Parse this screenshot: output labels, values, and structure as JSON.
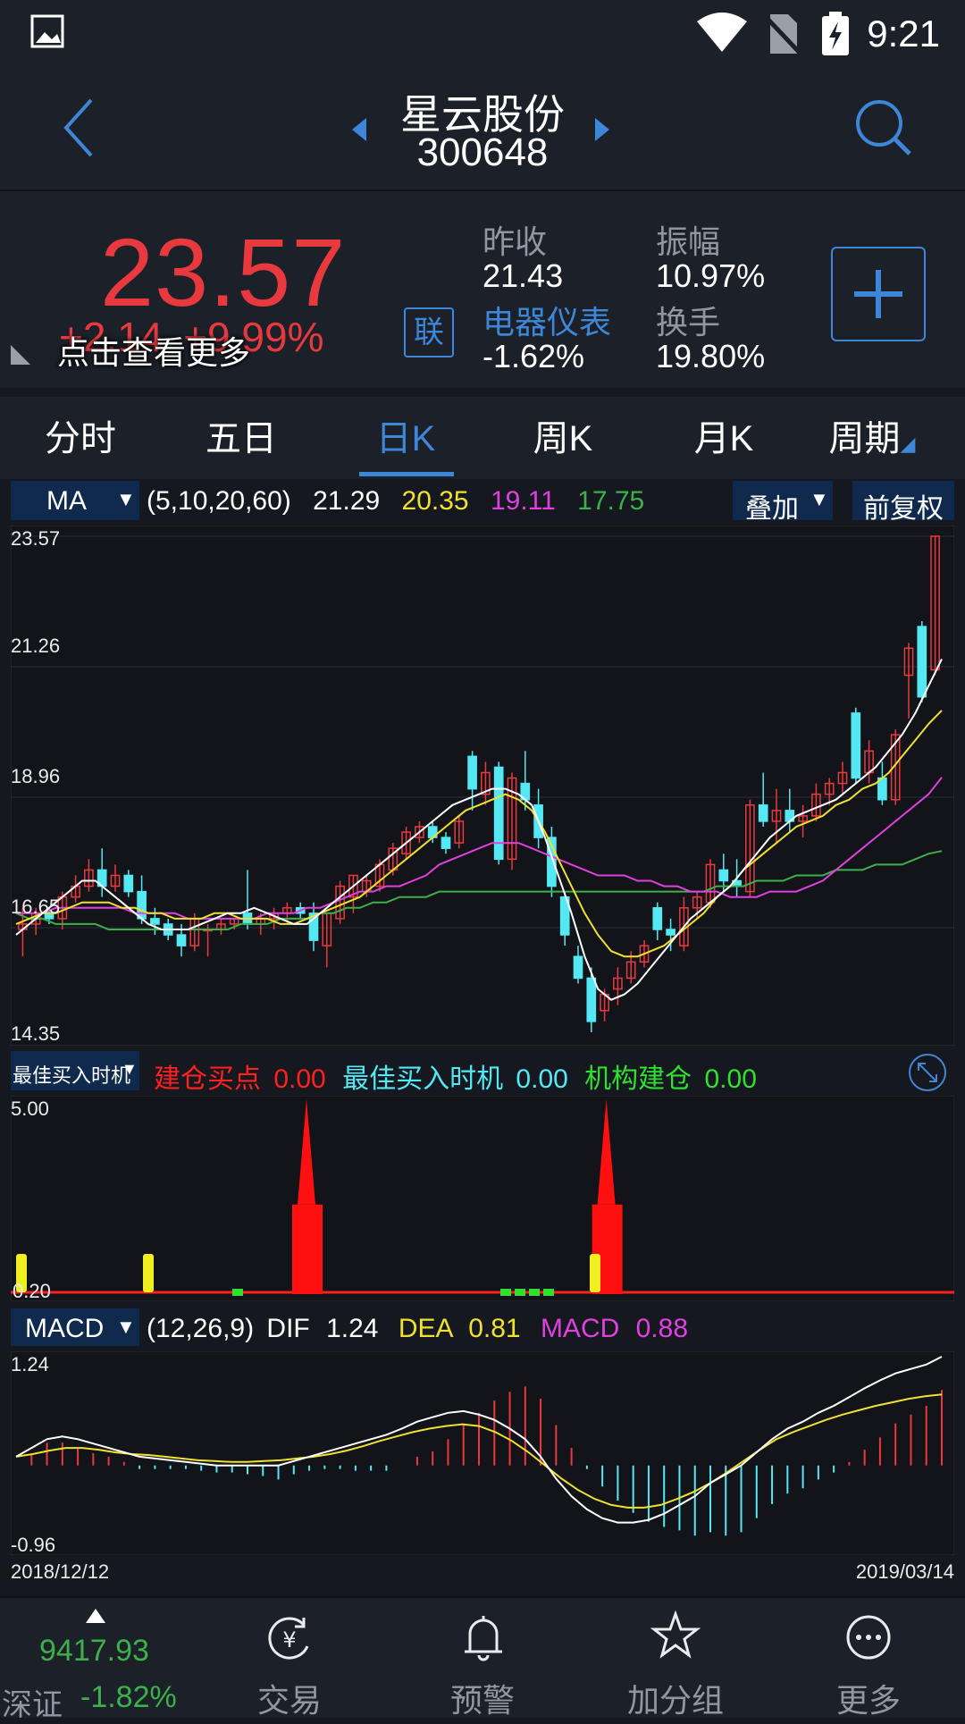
{
  "status": {
    "time": "9:21"
  },
  "header": {
    "stock_name": "星云股份",
    "stock_code": "300648"
  },
  "quote": {
    "price": "23.57",
    "change": "+2.14",
    "change_pct": "+9.99%",
    "hint": "点击查看更多",
    "prev_close_label": "昨收",
    "prev_close": "21.43",
    "amplitude_label": "振幅",
    "amplitude": "10.97%",
    "sector_label": "电器仪表",
    "sector_change": "-1.62%",
    "turnover_label": "换手",
    "turnover": "19.80%",
    "link_label": "联"
  },
  "tabs": [
    {
      "label": "分时"
    },
    {
      "label": "五日"
    },
    {
      "label": "日K"
    },
    {
      "label": "周K"
    },
    {
      "label": "月K"
    },
    {
      "label": "周期"
    }
  ],
  "ma_bar": {
    "selector": "MA",
    "params": "(5,10,20,60)",
    "ma5": "21.29",
    "ma10": "20.35",
    "ma20": "19.11",
    "ma60": "17.75",
    "overlay_label": "叠加",
    "adjust_label": "前复权"
  },
  "price_axis": {
    "top": "23.57",
    "l2": "21.26",
    "l3": "18.96",
    "l4": "16.65",
    "bottom": "14.35"
  },
  "signal_bar": {
    "selector": "最佳买入时机",
    "build_label": "建仓买点",
    "build_val": "0.00",
    "best_label": "最佳买入时机",
    "best_val": "0.00",
    "inst_label": "机构建仓",
    "inst_val": "0.00",
    "axis_top": "5.00",
    "axis_bottom": "0.20"
  },
  "macd_bar": {
    "selector": "MACD",
    "params": "(12,26,9)",
    "dif_label": "DIF",
    "dif": "1.24",
    "dea_label": "DEA",
    "dea": "0.81",
    "macd_label": "MACD",
    "macd": "0.88",
    "axis_top": "1.24",
    "axis_bottom": "-0.96"
  },
  "dates": {
    "start": "2018/12/12",
    "end": "2019/03/14"
  },
  "bottom_nav": {
    "index_value": "9417.93",
    "index_name": "深证",
    "index_change": "-1.82%",
    "trade": "交易",
    "alert": "预警",
    "group": "加分组",
    "more": "更多"
  },
  "colors": {
    "up": "#e83a3e",
    "down": "#53e8f4",
    "accent": "#3e87d8",
    "ma5": "#ffffff",
    "ma10": "#f0e030",
    "ma20": "#e040e0",
    "ma60": "#3cb04a"
  },
  "chart_data": {
    "type": "candlestick",
    "ylim": [
      14.35,
      23.57
    ],
    "candles": [
      {
        "o": 16.3,
        "h": 16.7,
        "l": 15.8,
        "c": 16.4
      },
      {
        "o": 16.4,
        "h": 16.7,
        "l": 16.2,
        "c": 16.6
      },
      {
        "o": 16.6,
        "h": 16.7,
        "l": 16.4,
        "c": 16.5
      },
      {
        "o": 16.5,
        "h": 17.0,
        "l": 16.3,
        "c": 16.9
      },
      {
        "o": 16.9,
        "h": 17.3,
        "l": 16.8,
        "c": 17.1
      },
      {
        "o": 17.1,
        "h": 17.6,
        "l": 17.0,
        "c": 17.4
      },
      {
        "o": 17.4,
        "h": 17.8,
        "l": 16.9,
        "c": 17.1
      },
      {
        "o": 17.1,
        "h": 17.5,
        "l": 17.0,
        "c": 17.3
      },
      {
        "o": 17.3,
        "h": 17.4,
        "l": 16.9,
        "c": 17.0
      },
      {
        "o": 17.0,
        "h": 17.3,
        "l": 16.4,
        "c": 16.5
      },
      {
        "o": 16.5,
        "h": 16.7,
        "l": 16.2,
        "c": 16.4
      },
      {
        "o": 16.4,
        "h": 16.5,
        "l": 16.1,
        "c": 16.2
      },
      {
        "o": 16.2,
        "h": 16.4,
        "l": 15.8,
        "c": 16.0
      },
      {
        "o": 16.0,
        "h": 16.6,
        "l": 15.9,
        "c": 16.5
      },
      {
        "o": 16.3,
        "h": 16.4,
        "l": 15.8,
        "c": 16.3
      },
      {
        "o": 16.3,
        "h": 16.5,
        "l": 16.2,
        "c": 16.4
      },
      {
        "o": 16.4,
        "h": 16.5,
        "l": 16.3,
        "c": 16.5
      },
      {
        "o": 16.6,
        "h": 17.4,
        "l": 16.3,
        "c": 16.4
      },
      {
        "o": 16.4,
        "h": 16.6,
        "l": 16.2,
        "c": 16.5
      },
      {
        "o": 16.5,
        "h": 16.7,
        "l": 16.3,
        "c": 16.6
      },
      {
        "o": 16.6,
        "h": 16.8,
        "l": 16.4,
        "c": 16.7
      },
      {
        "o": 16.7,
        "h": 16.8,
        "l": 16.5,
        "c": 16.6
      },
      {
        "o": 16.6,
        "h": 16.8,
        "l": 15.9,
        "c": 16.1
      },
      {
        "o": 16.0,
        "h": 16.6,
        "l": 15.6,
        "c": 16.6
      },
      {
        "o": 16.5,
        "h": 17.2,
        "l": 16.4,
        "c": 17.1
      },
      {
        "o": 16.9,
        "h": 17.3,
        "l": 16.6,
        "c": 17.3
      },
      {
        "o": 17.0,
        "h": 17.3,
        "l": 16.9,
        "c": 17.2
      },
      {
        "o": 17.1,
        "h": 17.6,
        "l": 17.0,
        "c": 17.5
      },
      {
        "o": 17.4,
        "h": 17.9,
        "l": 17.3,
        "c": 17.8
      },
      {
        "o": 17.7,
        "h": 18.2,
        "l": 17.6,
        "c": 18.1
      },
      {
        "o": 18.0,
        "h": 18.3,
        "l": 17.9,
        "c": 18.2
      },
      {
        "o": 18.2,
        "h": 18.3,
        "l": 17.9,
        "c": 18.0
      },
      {
        "o": 18.0,
        "h": 18.1,
        "l": 17.7,
        "c": 17.8
      },
      {
        "o": 17.9,
        "h": 18.4,
        "l": 17.8,
        "c": 18.3
      },
      {
        "o": 19.5,
        "h": 19.6,
        "l": 18.5,
        "c": 18.9
      },
      {
        "o": 18.8,
        "h": 19.4,
        "l": 18.6,
        "c": 19.2
      },
      {
        "o": 19.3,
        "h": 19.4,
        "l": 17.5,
        "c": 17.6
      },
      {
        "o": 17.6,
        "h": 19.2,
        "l": 17.4,
        "c": 19.1
      },
      {
        "o": 19.0,
        "h": 19.6,
        "l": 18.5,
        "c": 18.7
      },
      {
        "o": 18.6,
        "h": 18.9,
        "l": 17.8,
        "c": 18.0
      },
      {
        "o": 18.0,
        "h": 18.2,
        "l": 16.9,
        "c": 17.1
      },
      {
        "o": 16.9,
        "h": 17.0,
        "l": 16.0,
        "c": 16.2
      },
      {
        "o": 15.8,
        "h": 16.0,
        "l": 15.3,
        "c": 15.4
      },
      {
        "o": 15.4,
        "h": 15.6,
        "l": 14.4,
        "c": 14.6
      },
      {
        "o": 14.8,
        "h": 15.2,
        "l": 14.6,
        "c": 15.1
      },
      {
        "o": 15.2,
        "h": 15.6,
        "l": 14.9,
        "c": 15.4
      },
      {
        "o": 15.4,
        "h": 15.9,
        "l": 15.3,
        "c": 15.7
      },
      {
        "o": 15.7,
        "h": 16.1,
        "l": 15.6,
        "c": 16.0
      },
      {
        "o": 16.7,
        "h": 16.8,
        "l": 16.1,
        "c": 16.3
      },
      {
        "o": 16.3,
        "h": 16.5,
        "l": 15.9,
        "c": 16.2
      },
      {
        "o": 16.0,
        "h": 16.9,
        "l": 15.9,
        "c": 16.7
      },
      {
        "o": 16.7,
        "h": 17.0,
        "l": 16.5,
        "c": 16.9
      },
      {
        "o": 16.8,
        "h": 17.6,
        "l": 16.7,
        "c": 17.5
      },
      {
        "o": 17.4,
        "h": 17.7,
        "l": 17.0,
        "c": 17.2
      },
      {
        "o": 17.2,
        "h": 17.6,
        "l": 16.9,
        "c": 17.1
      },
      {
        "o": 17.0,
        "h": 18.7,
        "l": 16.9,
        "c": 18.6
      },
      {
        "o": 18.6,
        "h": 19.2,
        "l": 18.2,
        "c": 18.3
      },
      {
        "o": 18.3,
        "h": 18.9,
        "l": 17.9,
        "c": 18.5
      },
      {
        "o": 18.5,
        "h": 18.9,
        "l": 18.1,
        "c": 18.3
      },
      {
        "o": 18.3,
        "h": 18.6,
        "l": 18.0,
        "c": 18.4
      },
      {
        "o": 18.4,
        "h": 19.0,
        "l": 18.3,
        "c": 18.8
      },
      {
        "o": 18.8,
        "h": 19.1,
        "l": 18.6,
        "c": 19.0
      },
      {
        "o": 19.0,
        "h": 19.4,
        "l": 18.8,
        "c": 19.2
      },
      {
        "o": 20.3,
        "h": 20.4,
        "l": 19.0,
        "c": 19.1
      },
      {
        "o": 19.2,
        "h": 19.8,
        "l": 19.0,
        "c": 19.6
      },
      {
        "o": 19.1,
        "h": 19.4,
        "l": 18.6,
        "c": 18.7
      },
      {
        "o": 18.7,
        "h": 20.0,
        "l": 18.6,
        "c": 19.9
      },
      {
        "o": 21.0,
        "h": 21.6,
        "l": 20.2,
        "c": 21.5
      },
      {
        "o": 21.9,
        "h": 22.0,
        "l": 20.5,
        "c": 20.6
      },
      {
        "o": 21.1,
        "h": 23.57,
        "l": 21.0,
        "c": 23.57
      }
    ],
    "ma5": [
      16.2,
      16.4,
      16.6,
      16.8,
      17.0,
      17.2,
      17.2,
      17.0,
      16.8,
      16.6,
      16.4,
      16.3,
      16.3,
      16.3,
      16.4,
      16.5,
      16.6,
      16.6,
      16.7,
      16.6,
      16.5,
      16.4,
      16.4,
      16.6,
      16.8,
      17.0,
      17.2,
      17.4,
      17.6,
      17.8,
      18.0,
      18.2,
      18.4,
      18.6,
      18.7,
      18.8,
      18.9,
      18.9,
      18.8,
      18.6,
      18.0,
      17.3,
      16.6,
      15.8,
      15.2,
      15.0,
      15.1,
      15.3,
      15.6,
      15.9,
      16.2,
      16.5,
      16.7,
      16.9,
      17.1,
      17.4,
      17.7,
      18.0,
      18.2,
      18.4,
      18.5,
      18.6,
      18.7,
      18.9,
      19.1,
      19.3,
      19.6,
      19.9,
      20.3,
      20.8,
      21.3
    ],
    "ma10": [
      16.4,
      16.5,
      16.6,
      16.6,
      16.7,
      16.8,
      16.8,
      16.8,
      16.7,
      16.7,
      16.6,
      16.6,
      16.5,
      16.5,
      16.5,
      16.6,
      16.6,
      16.5,
      16.5,
      16.5,
      16.4,
      16.4,
      16.5,
      16.6,
      16.7,
      16.8,
      16.9,
      17.1,
      17.3,
      17.5,
      17.7,
      17.9,
      18.1,
      18.3,
      18.5,
      18.6,
      18.7,
      18.8,
      18.7,
      18.5,
      18.1,
      17.6,
      17.1,
      16.6,
      16.2,
      15.9,
      15.8,
      15.8,
      15.9,
      16.0,
      16.2,
      16.4,
      16.6,
      16.9,
      17.1,
      17.4,
      17.6,
      17.8,
      18.0,
      18.2,
      18.3,
      18.4,
      18.6,
      18.7,
      18.9,
      19.0,
      19.2,
      19.5,
      19.8,
      20.1,
      20.35
    ],
    "ma20": [
      16.6,
      16.6,
      16.6,
      16.7,
      16.7,
      16.7,
      16.7,
      16.7,
      16.7,
      16.6,
      16.6,
      16.6,
      16.6,
      16.5,
      16.5,
      16.5,
      16.5,
      16.5,
      16.5,
      16.6,
      16.6,
      16.6,
      16.7,
      16.7,
      16.8,
      16.9,
      17.0,
      17.0,
      17.1,
      17.1,
      17.2,
      17.3,
      17.5,
      17.6,
      17.7,
      17.8,
      17.9,
      17.9,
      17.9,
      17.8,
      17.7,
      17.6,
      17.5,
      17.4,
      17.3,
      17.3,
      17.3,
      17.2,
      17.2,
      17.1,
      17.1,
      17.0,
      17.0,
      17.0,
      16.9,
      16.9,
      16.9,
      17.0,
      17.0,
      17.0,
      17.1,
      17.2,
      17.4,
      17.6,
      17.8,
      18.0,
      18.2,
      18.4,
      18.6,
      18.8,
      19.11
    ],
    "ma60": [
      16.6,
      16.5,
      16.5,
      16.4,
      16.4,
      16.4,
      16.4,
      16.3,
      16.3,
      16.3,
      16.3,
      16.3,
      16.3,
      16.3,
      16.3,
      16.3,
      16.3,
      16.4,
      16.4,
      16.4,
      16.5,
      16.5,
      16.5,
      16.6,
      16.6,
      16.7,
      16.7,
      16.8,
      16.8,
      16.9,
      16.9,
      16.9,
      17.0,
      17.0,
      17.0,
      17.0,
      17.0,
      17.0,
      17.0,
      17.0,
      17.0,
      17.0,
      17.0,
      17.0,
      17.0,
      17.0,
      17.0,
      17.0,
      17.0,
      17.0,
      17.0,
      17.0,
      17.0,
      17.1,
      17.1,
      17.1,
      17.2,
      17.2,
      17.2,
      17.3,
      17.3,
      17.3,
      17.4,
      17.4,
      17.4,
      17.5,
      17.5,
      17.5,
      17.6,
      17.7,
      17.75
    ],
    "signal": [
      0.2,
      0.2,
      0.2,
      0.2,
      0.2,
      0.2,
      0.2,
      0.2,
      0.2,
      0.2,
      0.2,
      0.2,
      0.2,
      0.2,
      0.2,
      0.2,
      0.2,
      0.2,
      0.2,
      0.2,
      0.2,
      0.2,
      5.0,
      0.2,
      0.2,
      0.2,
      0.2,
      0.2,
      0.2,
      0.2,
      0.2,
      0.2,
      0.2,
      0.2,
      0.2,
      0.2,
      0.2,
      0.2,
      0.2,
      0.2,
      0.2,
      0.2,
      0.2,
      0.2,
      0.2,
      5.0,
      0.2,
      0.2,
      0.2,
      0.2,
      0.2,
      0.2,
      0.2,
      0.2,
      0.2,
      0.2,
      0.2,
      0.2,
      0.2,
      0.2,
      0.2,
      0.2,
      0.2,
      0.2,
      0.2,
      0.2,
      0.2,
      0.2,
      0.2,
      0.2,
      0.2
    ],
    "macd_ylim": [
      -0.96,
      1.24
    ],
    "dif": [
      0.1,
      0.2,
      0.3,
      0.33,
      0.3,
      0.25,
      0.2,
      0.15,
      0.1,
      0.08,
      0.06,
      0.04,
      0.02,
      0.0,
      0.0,
      0.0,
      0.0,
      0.0,
      0.05,
      0.1,
      0.15,
      0.2,
      0.25,
      0.3,
      0.35,
      0.42,
      0.5,
      0.55,
      0.6,
      0.62,
      0.58,
      0.52,
      0.42,
      0.3,
      0.1,
      -0.15,
      -0.35,
      -0.5,
      -0.6,
      -0.65,
      -0.65,
      -0.62,
      -0.55,
      -0.45,
      -0.35,
      -0.2,
      -0.1,
      0.0,
      0.15,
      0.3,
      0.42,
      0.5,
      0.6,
      0.68,
      0.78,
      0.88,
      0.97,
      1.05,
      1.1,
      1.15,
      1.24
    ],
    "dea": [
      0.1,
      0.13,
      0.17,
      0.2,
      0.2,
      0.18,
      0.15,
      0.13,
      0.12,
      0.1,
      0.08,
      0.06,
      0.05,
      0.04,
      0.04,
      0.05,
      0.06,
      0.08,
      0.1,
      0.13,
      0.17,
      0.22,
      0.28,
      0.33,
      0.38,
      0.42,
      0.45,
      0.47,
      0.45,
      0.38,
      0.28,
      0.15,
      0.0,
      -0.15,
      -0.28,
      -0.38,
      -0.45,
      -0.48,
      -0.48,
      -0.45,
      -0.38,
      -0.3,
      -0.2,
      -0.08,
      0.05,
      0.18,
      0.3,
      0.38,
      0.45,
      0.52,
      0.58,
      0.63,
      0.68,
      0.72,
      0.76,
      0.79,
      0.81
    ]
  }
}
